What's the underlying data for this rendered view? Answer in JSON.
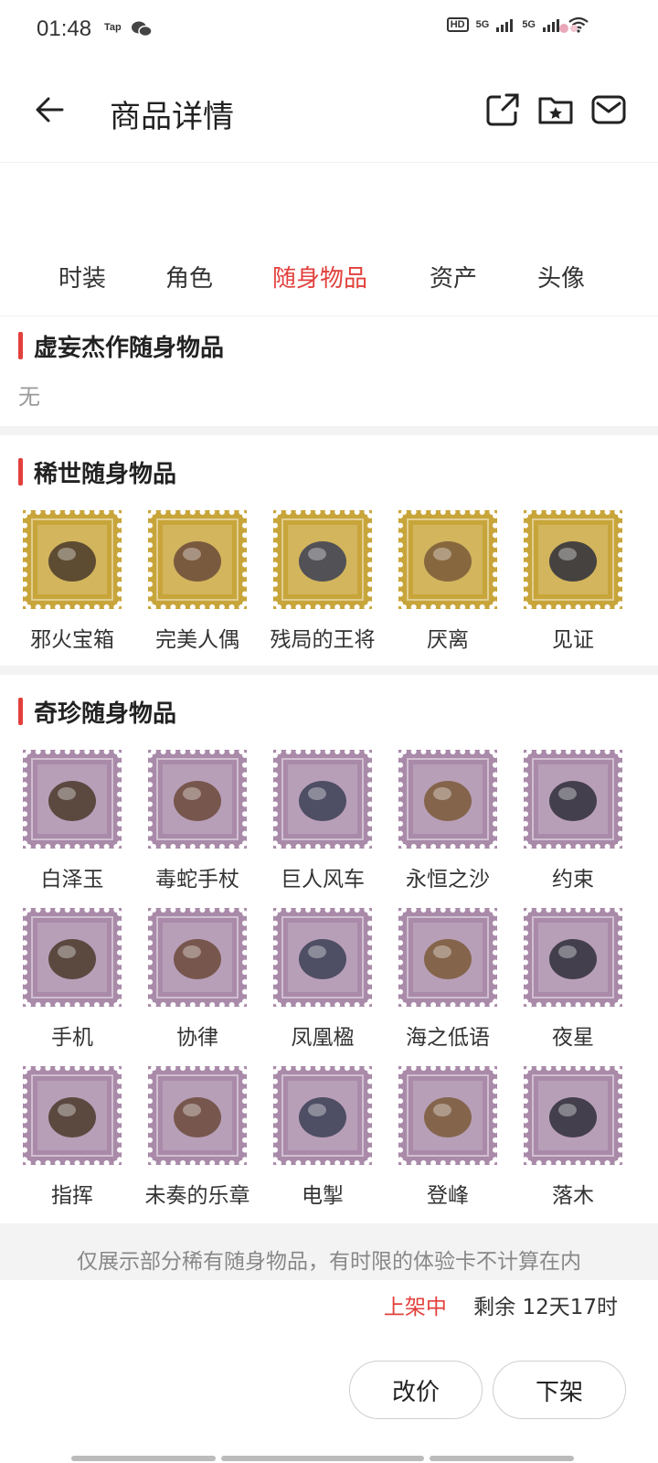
{
  "status": {
    "time": "01:48",
    "apps": [
      "Tap",
      "wechat-icon"
    ],
    "signal_labels": [
      "HD",
      "5G",
      "5G"
    ]
  },
  "header": {
    "title": "商品详情",
    "icons": [
      "share-icon",
      "favorite-folder-icon",
      "message-icon"
    ]
  },
  "tabs": [
    "时装",
    "角色",
    "随身物品",
    "资产",
    "头像"
  ],
  "active_tab": "随身物品",
  "sections": {
    "masterpiece": {
      "title": "虚妄杰作随身物品",
      "empty_text": "无"
    },
    "rare": {
      "title": "稀世随身物品",
      "stamp_color": "#c8a53a",
      "items": [
        "邪火宝箱",
        "完美人偶",
        "残局的王将",
        "厌离",
        "见证"
      ]
    },
    "exotic": {
      "title": "奇珍随身物品",
      "stamp_color": "#a98aa9",
      "items": [
        "白泽玉",
        "毒蛇手杖",
        "巨人风车",
        "永恒之沙",
        "约束",
        "手机",
        "协律",
        "凤凰楹",
        "海之低语",
        "夜星",
        "指挥",
        "未奏的乐章",
        "电掣",
        "登峰",
        "落木"
      ]
    }
  },
  "footnote": "仅展示部分稀有随身物品，有时限的体验卡不计算在内",
  "listing": {
    "status": "上架中",
    "remaining": "剩余 12天17时"
  },
  "buttons": {
    "reprice": "改价",
    "delist": "下架"
  },
  "colors": {
    "accent": "#e2403c"
  }
}
